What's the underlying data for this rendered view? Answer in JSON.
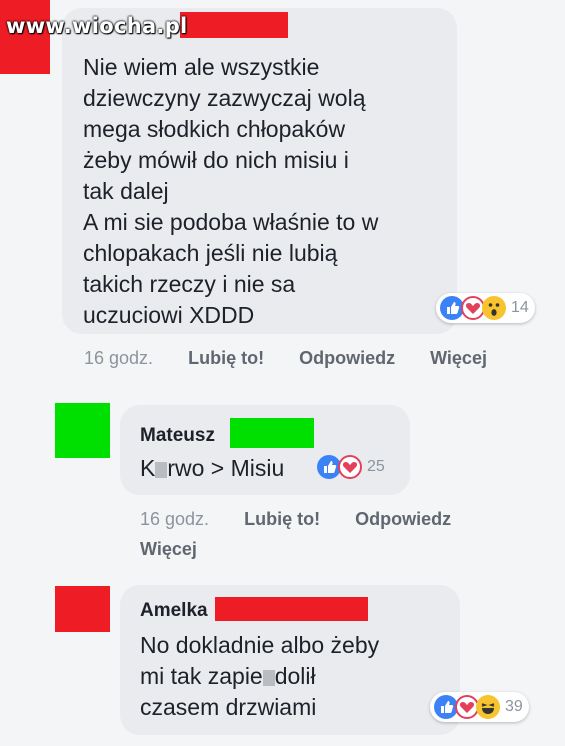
{
  "watermark": "www.wiocha.pl",
  "colors": {
    "redact_red": "#ee1c24",
    "redact_green": "#00e000",
    "link": "#606770",
    "meta": "#8d949e"
  },
  "comments": [
    {
      "text": "Nie wiem ale wszystkie\ndziewczyny zazwyczaj wolą\nmega słodkich chłopaków\nżeby mówił do nich misiu i\ntak dalej\nA mi sie podoba właśnie to w\nchlopakach jeśli nie lubią\ntakich rzeczy i nie sa\nuczuciowi XDDD",
      "reactions": {
        "icons": [
          "like-icon",
          "love-icon",
          "wow-icon"
        ],
        "count": "14"
      },
      "actions": {
        "time": "16 godz.",
        "like": "Lubię to!",
        "reply": "Odpowiedz",
        "more": "Więcej"
      }
    },
    {
      "author": "Mateusz",
      "text_before": "K",
      "text_after": "rwo > Misiu",
      "reactions": {
        "icons": [
          "like-icon",
          "love-icon"
        ],
        "count": "25"
      },
      "actions": {
        "time": "16 godz.",
        "like": "Lubię to!",
        "reply": "Odpowiedz",
        "more": "Więcej"
      }
    },
    {
      "author": "Amelka",
      "line1": "No dokladnie albo żeby",
      "line2_before": "mi tak zapie",
      "line2_after": "dolił",
      "line3": "czasem drzwiami",
      "reactions": {
        "icons": [
          "like-icon",
          "love-icon",
          "haha-icon"
        ],
        "count": "39"
      }
    }
  ]
}
